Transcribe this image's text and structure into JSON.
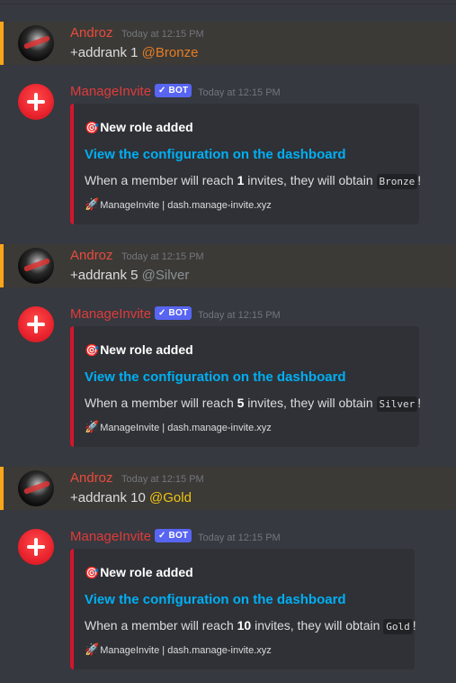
{
  "messages": [
    {
      "type": "user",
      "author": "Androz",
      "timestamp": "Today at 12:15 PM",
      "command": "+addrank 1",
      "mention": "@Bronze"
    },
    {
      "type": "bot",
      "author": "ManageInvite",
      "badge": "✓ BOT",
      "timestamp": "Today at 12:15 PM",
      "embed": {
        "title_emoji": "🎯",
        "title": "New role added",
        "link": "View the configuration on the dashboard",
        "desc_pre": "When a member will reach ",
        "count": "1",
        "desc_mid": " invites, they will obtain ",
        "role": "Bronze",
        "desc_post": "!",
        "footer_emoji": "🚀",
        "footer": "ManageInvite | dash.manage-invite.xyz"
      }
    },
    {
      "type": "user",
      "author": "Androz",
      "timestamp": "Today at 12:15 PM",
      "command": "+addrank 5",
      "mention": "@Silver"
    },
    {
      "type": "bot",
      "author": "ManageInvite",
      "badge": "✓ BOT",
      "timestamp": "Today at 12:15 PM",
      "embed": {
        "title_emoji": "🎯",
        "title": "New role added",
        "link": "View the configuration on the dashboard",
        "desc_pre": "When a member will reach ",
        "count": "5",
        "desc_mid": " invites, they will obtain ",
        "role": "Silver",
        "desc_post": "!",
        "footer_emoji": "🚀",
        "footer": "ManageInvite | dash.manage-invite.xyz"
      }
    },
    {
      "type": "user",
      "author": "Androz",
      "timestamp": "Today at 12:15 PM",
      "command": "+addrank 10",
      "mention": "@Gold"
    },
    {
      "type": "bot",
      "author": "ManageInvite",
      "badge": "✓ BOT",
      "timestamp": "Today at 12:15 PM",
      "embed": {
        "title_emoji": "🎯",
        "title": "New role added",
        "link": "View the configuration on the dashboard",
        "desc_pre": "When a member will reach ",
        "count": "10",
        "desc_mid": " invites, they will obtain ",
        "role": "Gold",
        "desc_post": "!",
        "footer_emoji": "🚀",
        "footer": "ManageInvite | dash.manage-invite.xyz"
      }
    }
  ],
  "colors": {
    "background": "#36393f",
    "highlight_background": "#3c3a37",
    "highlight_border": "#faa61a",
    "embed_background": "#2f3136",
    "embed_border": "#d4152c",
    "link": "#00aff4",
    "bronze": "#e67e22",
    "silver": "#8a9296",
    "gold": "#f1c40f",
    "bot_badge": "#5865f2"
  },
  "icons": {
    "user_avatar": "androz-avatar",
    "bot_avatar": "manageinvite-plus-avatar"
  }
}
